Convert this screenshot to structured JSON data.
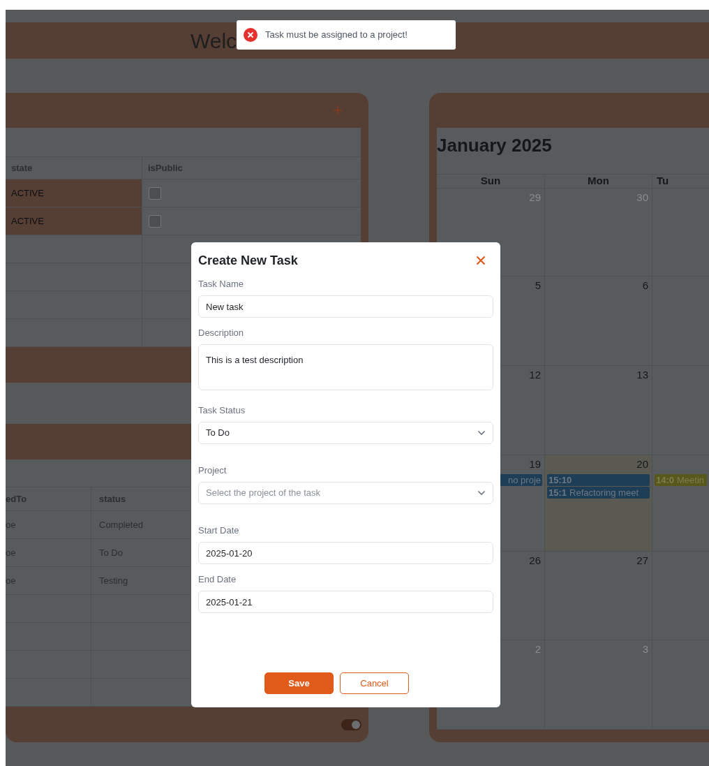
{
  "header": {
    "title": "Welc"
  },
  "toast": {
    "kind": "error",
    "message": "Task must be assigned to a project!"
  },
  "projects_panel": {
    "columns": [
      "state",
      "isPublic"
    ],
    "rows": [
      {
        "state": "ACTIVE",
        "color": "#553e34",
        "is_public": false
      },
      {
        "state": "ACTIVE",
        "color": "#553e34",
        "is_public": false
      }
    ]
  },
  "tasks_panel": {
    "columns": [
      "edTo",
      "status"
    ],
    "rows": [
      {
        "column_1": "oe",
        "status": "Completed"
      },
      {
        "column_1": "oe",
        "status": "To Do"
      },
      {
        "column_1": "oe",
        "status": "Testing"
      }
    ],
    "toggle": {
      "on": true
    }
  },
  "calendar": {
    "title": "January 2025",
    "weekdays": [
      "Sun",
      "Mon",
      "Tu"
    ],
    "weeks": [
      {
        "sun": {
          "day": "29",
          "outside": true
        },
        "mon": {
          "day": "30",
          "outside": true
        }
      },
      {
        "sun": {
          "day": "5",
          "outside": false
        },
        "mon": {
          "day": "6",
          "outside": false
        }
      },
      {
        "sun": {
          "day": "12",
          "outside": false
        },
        "mon": {
          "day": "13",
          "outside": false
        }
      },
      {
        "sun": {
          "day": "19",
          "outside": false,
          "events": [
            {
              "title": "no proje",
              "color": "#1e3d57"
            }
          ]
        },
        "mon": {
          "day": "20",
          "outside": false,
          "today": true,
          "events": [
            {
              "time": "15:10",
              "color": "#1e3d57"
            },
            {
              "time": "15:1",
              "title": "Refactoring meet",
              "color": "#1e3d57"
            }
          ]
        },
        "tue": {
          "events": [
            {
              "time": "14:0",
              "title": "Meetin",
              "color": "#57581b"
            }
          ]
        }
      },
      {
        "sun": {
          "day": "26",
          "outside": false
        },
        "mon": {
          "day": "27",
          "outside": false
        }
      },
      {
        "sun": {
          "day": "2",
          "outside": true
        },
        "mon": {
          "day": "3",
          "outside": true
        }
      }
    ]
  },
  "modal": {
    "title": "Create New Task",
    "fields": [
      {
        "kind": "text",
        "label": "Task Name",
        "value": "New task"
      },
      {
        "kind": "textarea",
        "label": "Description",
        "value": "This is a test description"
      },
      {
        "kind": "select",
        "label": "Task Status",
        "value": "To Do"
      },
      {
        "kind": "select",
        "label": "Project",
        "placeholder": "Select the project of the task"
      },
      {
        "kind": "date",
        "label": "Start Date",
        "value": "2025-01-20"
      },
      {
        "kind": "date",
        "label": "End Date",
        "value": "2025-01-21"
      }
    ],
    "buttons": [
      {
        "label": "Save",
        "kind": "primary"
      },
      {
        "label": "Cancel",
        "kind": "secondary"
      }
    ]
  }
}
